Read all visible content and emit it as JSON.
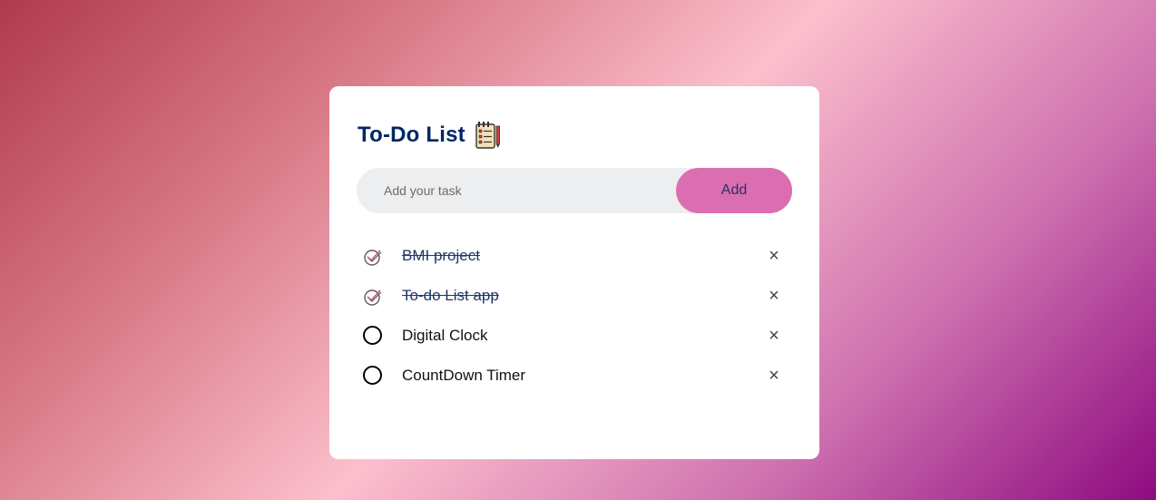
{
  "app": {
    "title": "To-Do List",
    "title_icon": "notepad-checklist-icon"
  },
  "input": {
    "placeholder": "Add your task",
    "value": "",
    "add_label": "Add"
  },
  "tasks": [
    {
      "text": "BMI project",
      "done": true
    },
    {
      "text": "To-do List app",
      "done": true
    },
    {
      "text": "Digital Clock",
      "done": false
    },
    {
      "text": "CountDown Timer",
      "done": false
    }
  ],
  "delete_symbol": "×",
  "colors": {
    "title": "#002765",
    "button": "#db6eb0",
    "input_bg": "#edeef0",
    "bg_start": "#b03a50",
    "bg_mid": "#fcbfcc",
    "bg_end": "#8e0b80"
  }
}
